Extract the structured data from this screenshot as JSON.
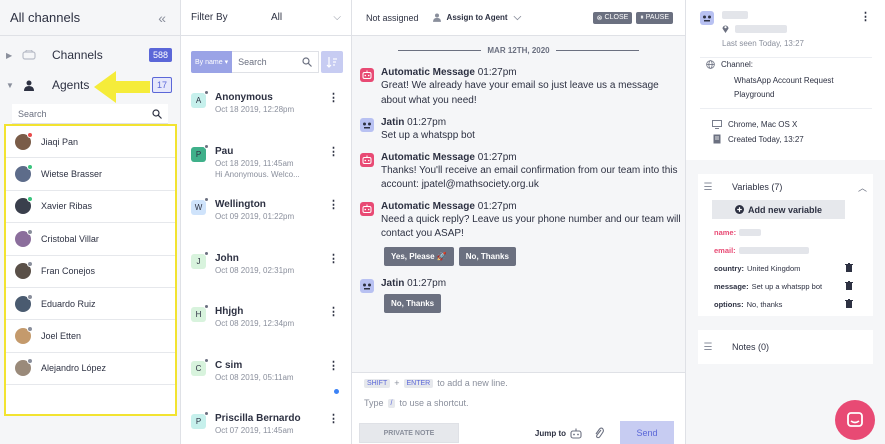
{
  "col1": {
    "title": "All channels",
    "collapse": "«",
    "channels": {
      "label": "Channels",
      "count": "588"
    },
    "agents": {
      "label": "Agents",
      "count": "17"
    },
    "search_placeholder": "Search",
    "agent_list": [
      {
        "name": "Jiaqi Pan",
        "status": "red"
      },
      {
        "name": "Wietse Brasser",
        "status": "green"
      },
      {
        "name": "Xavier Ribas",
        "status": "green"
      },
      {
        "name": "Cristobal Villar",
        "status": "gray"
      },
      {
        "name": "Fran Conejos",
        "status": "gray"
      },
      {
        "name": "Eduardo Ruiz",
        "status": "gray"
      },
      {
        "name": "Joel Etten",
        "status": "gray"
      },
      {
        "name": "Alejandro López",
        "status": "gray"
      }
    ]
  },
  "col2": {
    "filter_label": "Filter By",
    "filter_value": "All",
    "search_mode": "By name",
    "search_placeholder": "Search",
    "conversations": [
      {
        "initial": "A",
        "color": "#c6f0ec",
        "name": "Anonymous",
        "date": "Oct 18 2019, 12:28pm",
        "preview": "",
        "unread": false
      },
      {
        "initial": "P",
        "color": "#3fb08a",
        "name": "Pau",
        "date": "Oct 18 2019, 11:45am",
        "preview": "Hi Anonymous. Welco...",
        "unread": false
      },
      {
        "initial": "W",
        "color": "#cfe3fb",
        "name": "Wellington",
        "date": "Oct 09 2019, 01:22pm",
        "preview": "",
        "unread": false
      },
      {
        "initial": "J",
        "color": "#d8f3dd",
        "name": "John",
        "date": "Oct 08 2019, 02:31pm",
        "preview": "",
        "unread": false
      },
      {
        "initial": "H",
        "color": "#d8f3dd",
        "name": "Hhjgh",
        "date": "Oct 08 2019, 12:34pm",
        "preview": "",
        "unread": false
      },
      {
        "initial": "C",
        "color": "#d8f3dd",
        "name": "C sim",
        "date": "Oct 08 2019, 05:11am",
        "preview": "",
        "unread": true
      },
      {
        "initial": "P",
        "color": "#c6f0ec",
        "name": "Priscilla Bernardo",
        "date": "Oct 07 2019, 11:45am",
        "preview": "",
        "unread": false
      }
    ]
  },
  "col3": {
    "not_assigned": "Not assigned",
    "assign_to": "Assign to Agent",
    "close_label": "CLOSE",
    "pause_label": "PAUSE",
    "date_separator": "MAR 12TH, 2020",
    "messages": [
      {
        "kind": "bot",
        "sender": "Automatic Message",
        "time": "01:27pm",
        "text": "Great! We already have your email so just leave us a message about what you need!"
      },
      {
        "kind": "user",
        "sender": "Jatin",
        "time": "01:27pm",
        "text": "Set up a whatspp bot"
      },
      {
        "kind": "bot",
        "sender": "Automatic Message",
        "time": "01:27pm",
        "text": "Thanks! You'll receive an email confirmation from our team into this account: jpatel@mathsociety.org.uk"
      },
      {
        "kind": "bot",
        "sender": "Automatic Message",
        "time": "01:27pm",
        "text": "Need a quick reply? Leave us your phone number and our team will contact you ASAP!",
        "replies": [
          "Yes, Please 🚀",
          "No, Thanks"
        ]
      },
      {
        "kind": "user",
        "sender": "Jatin",
        "time": "01:27pm",
        "text": "",
        "replies": [
          "No, Thanks"
        ]
      }
    ],
    "composer": {
      "key1": "SHIFT",
      "plus": "+",
      "key2": "ENTER",
      "hint1": "to add a new line.",
      "type_label": "Type",
      "slash": "/",
      "hint2": "to use a shortcut.",
      "private_note": "PRIVATE NOTE",
      "jump_to": "Jump to",
      "send": "Send"
    }
  },
  "col4": {
    "last_seen": "Last seen Today, 13:27",
    "channel_label": "Channel:",
    "channel_value": "WhatsApp Account Request Playground",
    "browser": "Chrome, Mac OS X",
    "created": "Created Today, 13:27",
    "variables_title": "Variables (7)",
    "add_variable": "Add new variable",
    "variables": [
      {
        "key": "name:",
        "value": "",
        "hidden": true,
        "deletable": false
      },
      {
        "key": "email:",
        "value": "",
        "hidden": true,
        "deletable": false
      },
      {
        "key": "country:",
        "value": "United Kingdom",
        "hidden": false,
        "deletable": true
      },
      {
        "key": "message:",
        "value": "Set up a whatspp bot",
        "hidden": false,
        "deletable": true
      },
      {
        "key": "options:",
        "value": "No, thanks",
        "hidden": false,
        "deletable": true
      }
    ],
    "notes_title": "Notes (0)"
  },
  "colors": {
    "accent": "#5b67d8",
    "highlight": "#f2e330",
    "bot": "#e84a74",
    "fab": "#e84a74"
  }
}
